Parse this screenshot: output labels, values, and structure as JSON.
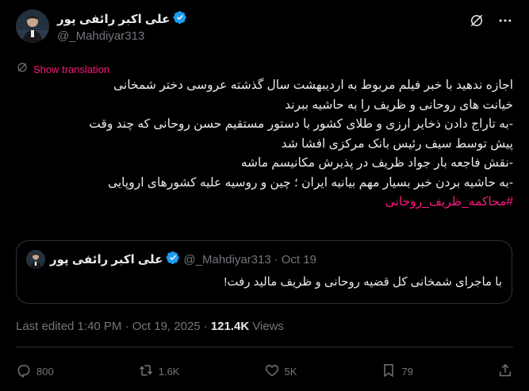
{
  "author": {
    "name": "علی اکبر رائفی پور",
    "handle": "@_Mahdiyar313"
  },
  "translate": {
    "label": "Show translation"
  },
  "tweet": {
    "lines": [
      "اجازه ندهید با خبر فیلم مربوط به اردیبهشت سال گذشته عروسی دختر شمخانی",
      "خیانت های روحانی و ظریف را به حاشیه ببرند",
      "-به تاراج دادن ذخایر ارزی و طلای کشور با دستور مستقیم حسن روحانی که چند وقت",
      "پیش توسط سیف رئیس بانک مرکزی افشا شد",
      "-نقش فاجعه بار جواد ظریف در پذیرش مکانیسم ماشه",
      "-به حاشیه بردن خبر بسیار مهم بیانیه ایران ؛ چین و روسیه علیه کشورهای اروپایی"
    ],
    "hashtag": "#محاکمه_ظریف_روحانی"
  },
  "quote": {
    "name": "علی اکبر رائفی پور",
    "handle": "@_Mahdiyar313",
    "separator": "·",
    "date": "Oct 19",
    "text": "با ماجرای شمخانی کل قضیه روحانی و ظریف مالید رفت!"
  },
  "meta": {
    "edited": "Last edited 1:40 PM · Oct 19, 2025 ·",
    "views_count": "121.4K",
    "views_label": "Views"
  },
  "actions": {
    "replies": "800",
    "reposts": "1.6K",
    "likes": "5K",
    "bookmarks": "79"
  },
  "colors": {
    "background": "#000000",
    "text": "#e7e9ea",
    "muted": "#71767b",
    "accent": "#f91880",
    "verified": "#1d9bf0",
    "border": "#2f3336"
  },
  "icons": {
    "top_left": "grok-icon",
    "top_right": "more-icon",
    "translate": "translate-icon",
    "reply": "reply-icon",
    "repost": "repost-icon",
    "like": "heart-icon",
    "bookmark": "bookmark-icon",
    "share": "share-icon"
  }
}
